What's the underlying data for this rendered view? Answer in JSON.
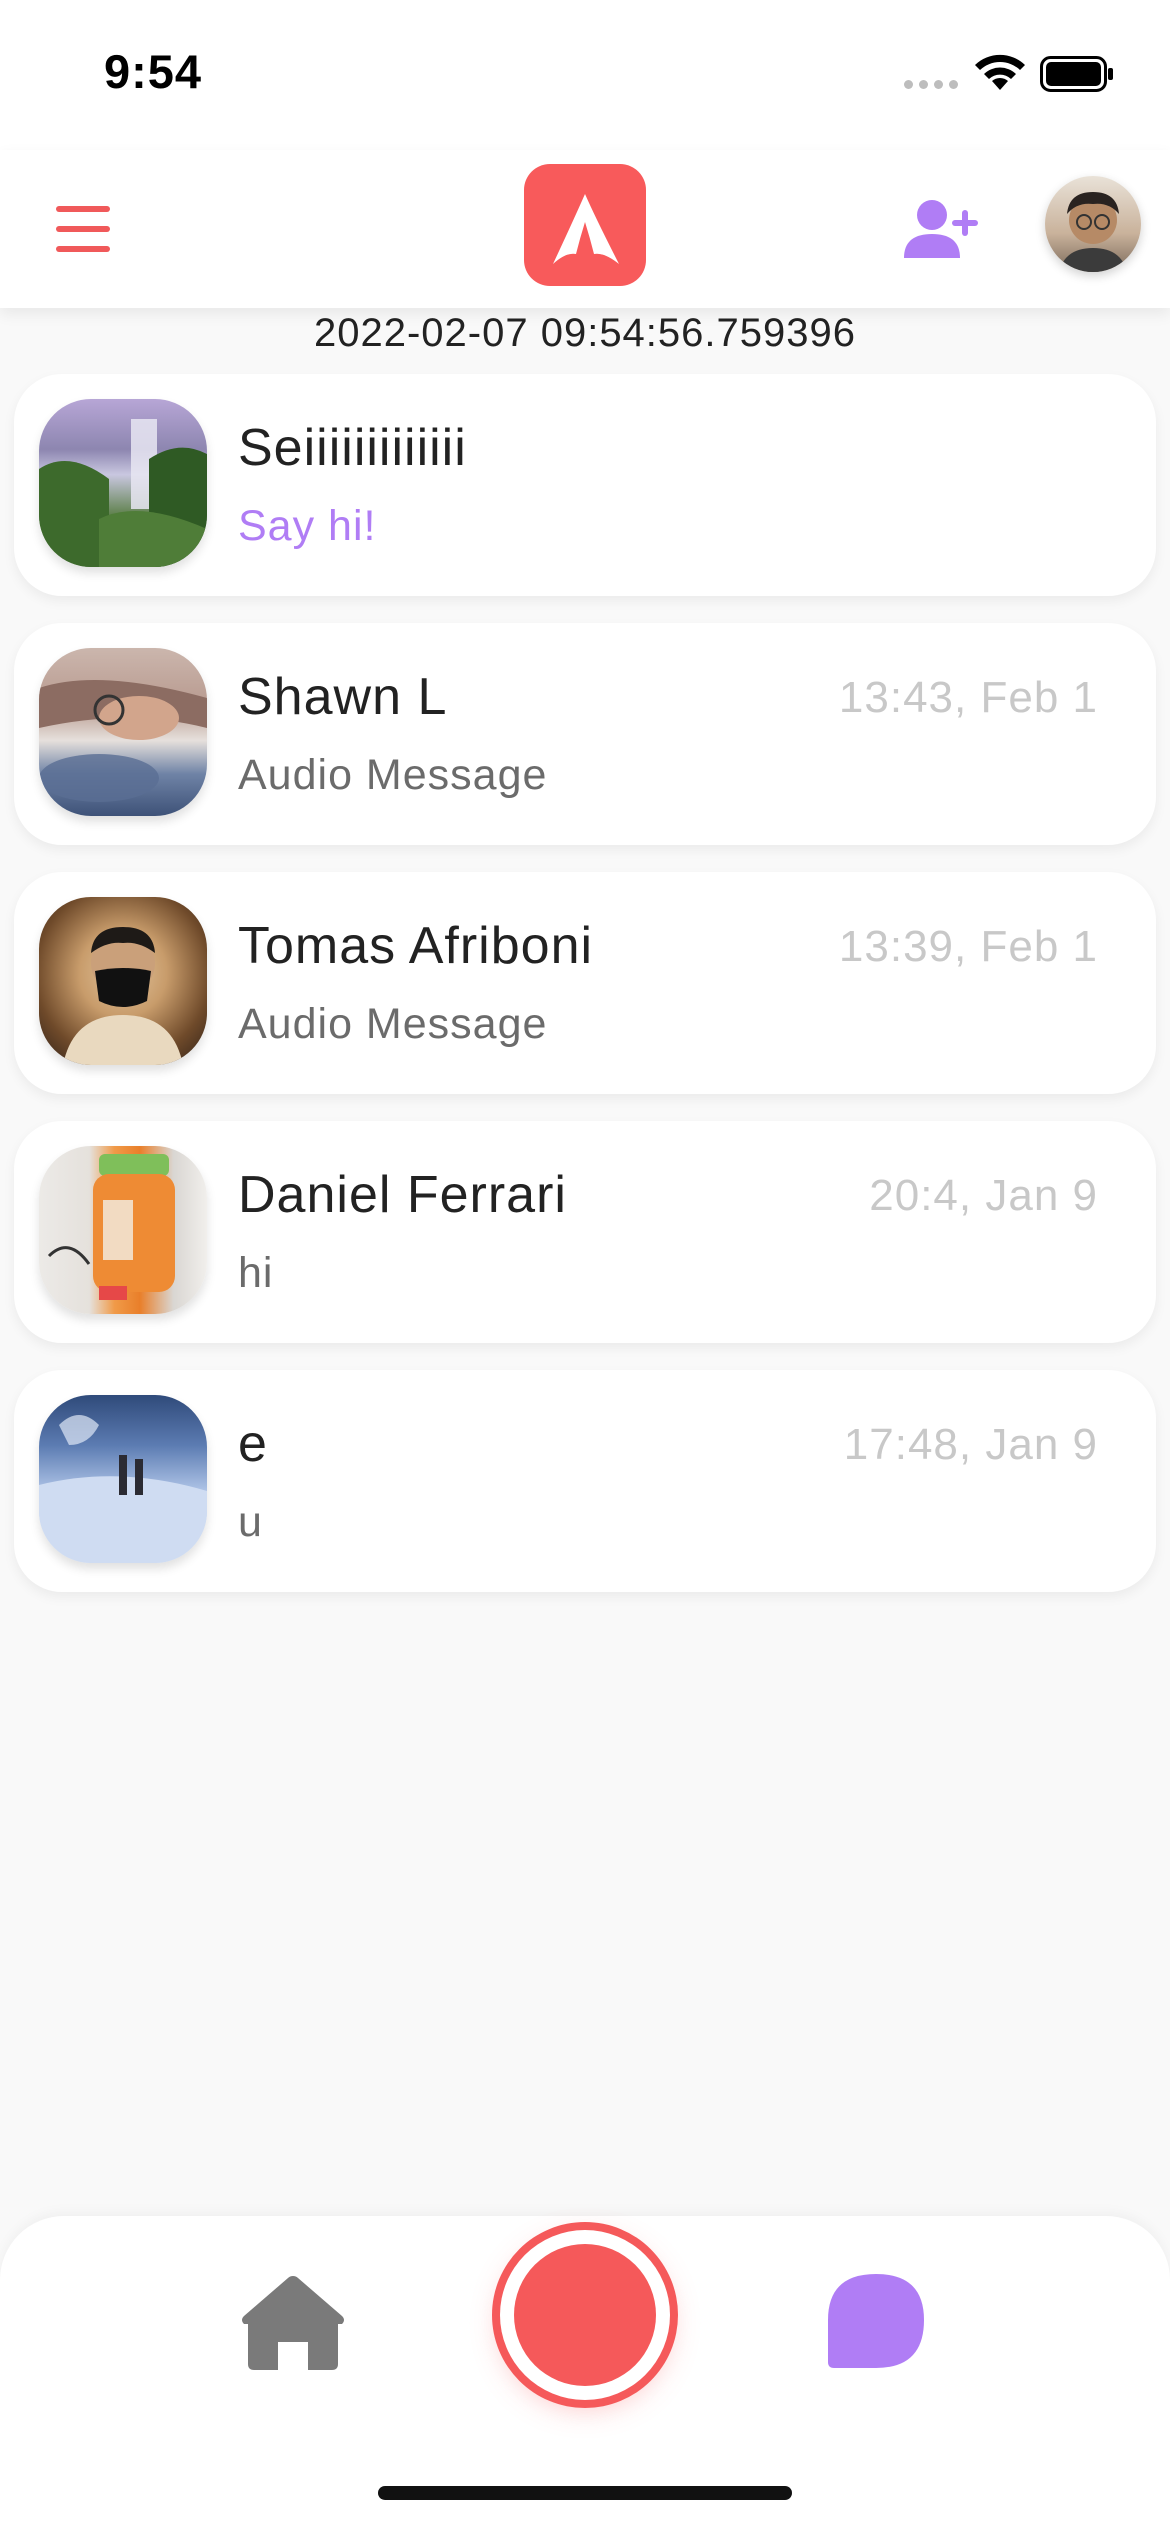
{
  "status_bar": {
    "time": "9:54",
    "icons": [
      "cellular-signal-icon",
      "wifi-icon",
      "battery-icon"
    ]
  },
  "header": {
    "icons": {
      "menu": "hamburger-menu-icon",
      "logo": "app-logo-icon",
      "add_user": "add-user-icon",
      "profile": "profile-avatar"
    },
    "colors": {
      "menu": "#f0595a",
      "logo": "#f85a5b",
      "add_user": "#b07df5"
    }
  },
  "timestamp": "2022-02-07 09:54:56.759396",
  "chats": [
    {
      "name": "Seiiiiiiiiiiiii",
      "time": "",
      "preview": "Say hi!",
      "avatar": "waterfall-photo"
    },
    {
      "name": "Shawn L",
      "time": "13:43, Feb 1",
      "preview": "Audio Message",
      "avatar": "person-photo"
    },
    {
      "name": "Tomas Afriboni",
      "time": "13:39, Feb 1",
      "preview": "Audio Message",
      "avatar": "masked-person-photo"
    },
    {
      "name": "Daniel Ferrari",
      "time": "20:4, Jan 9",
      "preview": "hi",
      "avatar": "orange-bottle-photo"
    },
    {
      "name": "e",
      "time": "17:48, Jan 9",
      "preview": "u",
      "avatar": "snow-photo"
    }
  ],
  "bottom_nav": {
    "icons": [
      "home-icon",
      "record-button",
      "chat-bubble-icon"
    ],
    "colors": {
      "home": "#7a7a7a",
      "record": "#f5595a",
      "chat": "#b07df5"
    }
  }
}
